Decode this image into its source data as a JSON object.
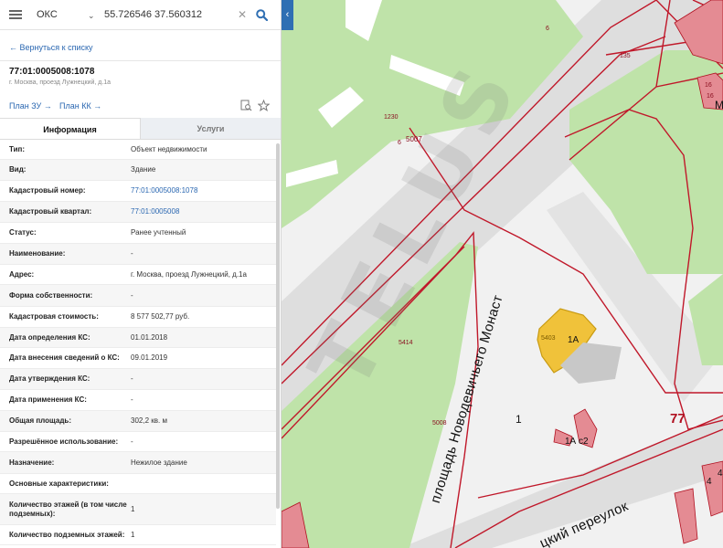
{
  "search": {
    "layer": "ОКС",
    "query": "55.726546 37.560312"
  },
  "nav": {
    "back_label": "← Вернуться к списку",
    "collapse_glyph": "‹"
  },
  "object": {
    "cad_number": "77:01:0005008:1078",
    "address": "г. Москва, проезд Лужнецкий, д.1а"
  },
  "plans": {
    "plan_zu": "План ЗУ →",
    "plan_kk": "План КК →"
  },
  "tabs": [
    {
      "label": "Информация",
      "active": true
    },
    {
      "label": "Услуги",
      "active": false
    }
  ],
  "info": [
    {
      "key": "Тип:",
      "value": "Объект недвижимости"
    },
    {
      "key": "Вид:",
      "value": "Здание"
    },
    {
      "key": "Кадастровый номер:",
      "value": "77:01:0005008:1078",
      "link": true
    },
    {
      "key": "Кадастровый квартал:",
      "value": "77:01:0005008",
      "link": true
    },
    {
      "key": "Статус:",
      "value": "Ранее учтенный"
    },
    {
      "key": "Наименование:",
      "value": "-"
    },
    {
      "key": "Адрес:",
      "value": "г. Москва, проезд Лужнецкий, д.1а"
    },
    {
      "key": "Форма собственности:",
      "value": "-"
    },
    {
      "key": "Кадастровая стоимость:",
      "value": "8 577 502,77 руб."
    },
    {
      "key": "Дата определения КС:",
      "value": "01.01.2018"
    },
    {
      "key": "Дата внесения сведений о КС:",
      "value": "09.01.2019"
    },
    {
      "key": "Дата утверждения КС:",
      "value": "-"
    },
    {
      "key": "Дата применения КС:",
      "value": "-"
    },
    {
      "key": "Общая площадь:",
      "value": "302,2 кв. м"
    },
    {
      "key": "Разрешённое использование:",
      "value": "-"
    },
    {
      "key": "Назначение:",
      "value": "Нежилое здание"
    },
    {
      "key": "Основные характеристики:",
      "value": ""
    },
    {
      "key": "Количество этажей (в том числе подземных):",
      "value": "1"
    },
    {
      "key": "Количество подземных этажей:",
      "value": "1"
    }
  ],
  "map": {
    "labels": {
      "n6": "6",
      "n135": "135",
      "n1230": "1230",
      "n6_5007": "6",
      "n5007": "5007",
      "n5414": "5414",
      "n5008": "5008",
      "n5403": "5403",
      "b1a": "1А",
      "b1ac2": "1А с2",
      "n1": "1",
      "n77": "77",
      "n16a": "16",
      "n16b": "16",
      "n4": "4",
      "m_cut": "М",
      "n4_cut": "4",
      "street_mon": "площадь Новодевичьего Монаст",
      "street_per": "цкий переулок"
    },
    "watermark": "TELUS",
    "colors": {
      "park": "#bfe3a9",
      "road_gray": "#d9d9d9",
      "boundary": "#c0182a",
      "building_pink": "#e48b93",
      "building_yellow": "#f0c23a"
    }
  }
}
